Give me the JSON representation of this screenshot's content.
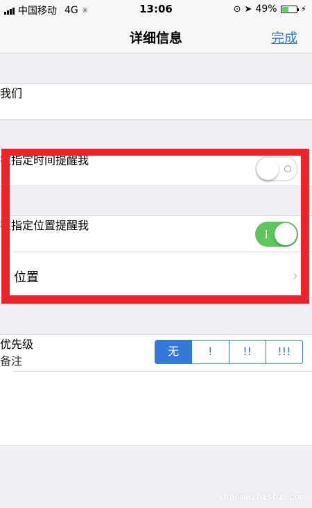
{
  "status_bar": {
    "carrier": "中国移动",
    "network": "4G",
    "time": "13:06",
    "battery": "49%",
    "battery_level": 0.49
  },
  "nav": {
    "title": "详细信息",
    "done": "完成"
  },
  "title_cell": "我们",
  "remind_time": {
    "label": "在指定时间提醒我",
    "on": false
  },
  "remind_location": {
    "label": "在指定位置提醒我",
    "on": true
  },
  "location": {
    "label": "位置"
  },
  "priority": {
    "label": "优先级",
    "options": [
      "无",
      "!",
      "!!",
      "!!!"
    ],
    "selected": "无"
  },
  "notes": {
    "label": "备注"
  },
  "watermark": "shenmazhishi.com",
  "colors": {
    "accent": "#3478d8",
    "switch_on": "#5cc75a",
    "highlight": "#f0222a"
  }
}
